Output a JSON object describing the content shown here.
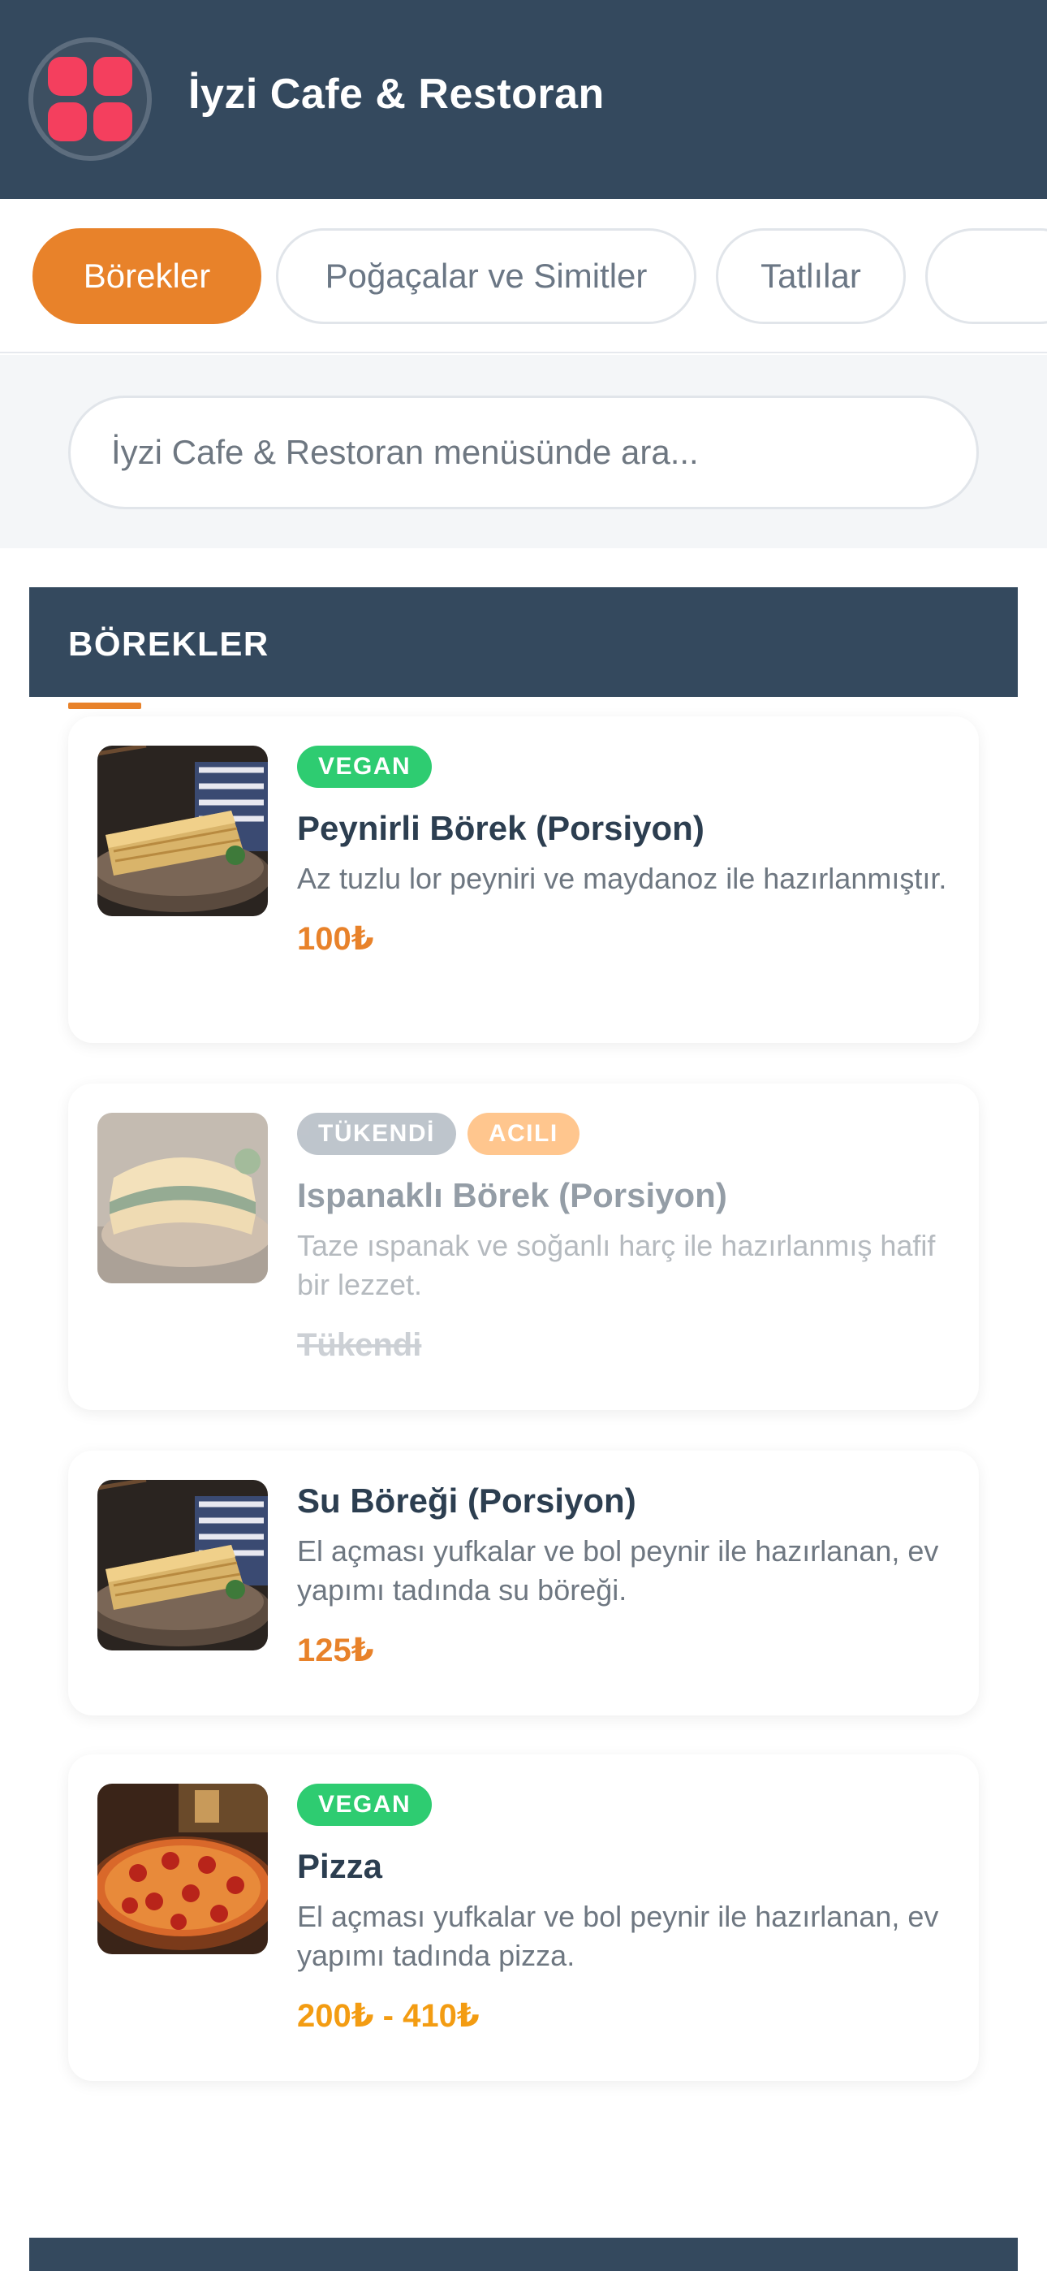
{
  "header": {
    "title": "İyzi Cafe & Restoran"
  },
  "tabs": [
    {
      "label": "Börekler",
      "active": true
    },
    {
      "label": "Poğaçalar ve Simitler",
      "active": false
    },
    {
      "label": "Tatlılar",
      "active": false
    },
    {
      "label": "",
      "active": false
    }
  ],
  "search": {
    "placeholder": "İyzi Cafe & Restoran menüsünde ara..."
  },
  "section": {
    "title": "BÖREKLER"
  },
  "items": [
    {
      "name": "Peynirli Börek (Porsiyon)",
      "description": "Az tuzlu lor peyniri ve maydanoz ile hazırlanmıştır.",
      "price": "100₺",
      "badges": [
        "VEGAN"
      ],
      "image": "borek-photo"
    },
    {
      "name": "Ispanaklı Börek (Porsiyon)",
      "description": "Taze ıspanak ve soğanlı harç ile hazırlanmış hafif bir lezzet.",
      "price": "Tükendi",
      "badges": [
        "TÜKENDİ",
        "ACILI"
      ],
      "image": "spinach-borek-photo",
      "sold_out": true
    },
    {
      "name": "Su Böreği (Porsiyon)",
      "description": "El açması yufkalar ve bol peynir ile hazırlanan, ev yapımı tadında su böreği.",
      "price": "125₺",
      "badges": [],
      "image": "borek-photo"
    },
    {
      "name": "Pizza",
      "description": "El açması yufkalar ve bol peynir ile hazırlanan, ev yapımı tadında pizza.",
      "price": "200₺ - 410₺",
      "badges": [
        "VEGAN"
      ],
      "image": "pizza-photo"
    }
  ],
  "colors": {
    "header_bg": "#34495e",
    "accent": "#e8822a",
    "vegan": "#2ecc71",
    "spicy": "#ff8f1f",
    "sold_out": "#7f8c9a",
    "logo": "#f43f5e"
  }
}
